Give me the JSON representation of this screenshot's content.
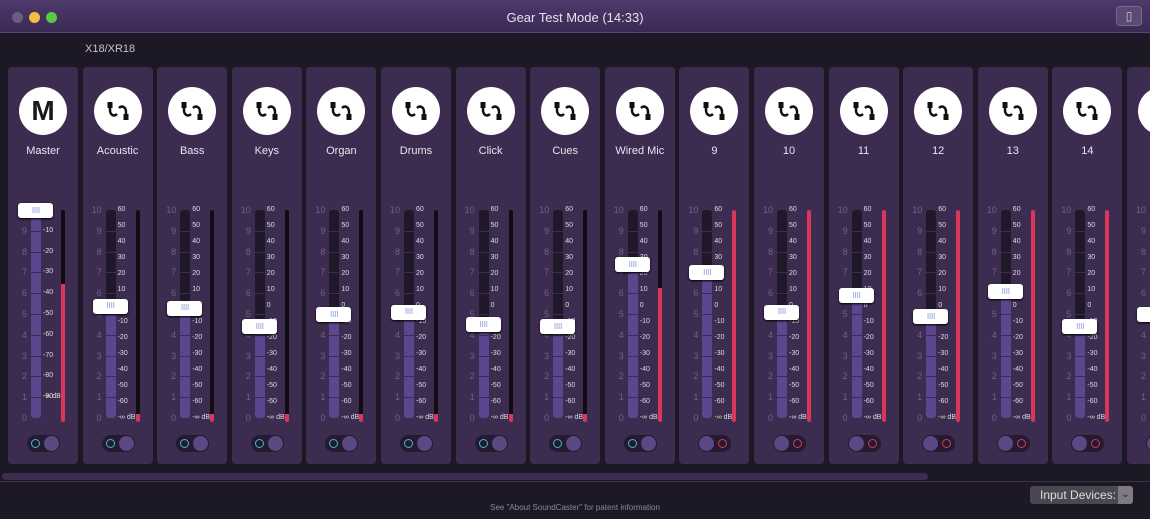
{
  "window": {
    "title": "Gear Test Mode (14:33)",
    "subtitle": "X18/XR18",
    "device_icon": "phone-icon"
  },
  "colors": {
    "meter": "#d8365a",
    "fader_fill": "#5d4690",
    "input_ring": "#3fb8c4",
    "output_ring": "#d8365a",
    "strip_bg": "#3c2d50"
  },
  "scales": {
    "fader": [
      "10",
      "9",
      "8",
      "7",
      "6",
      "5",
      "4",
      "3",
      "2",
      "1",
      "0"
    ],
    "channel_db": [
      "60",
      "50",
      "40",
      "30",
      "20",
      "10",
      "0",
      "-10",
      "-20",
      "-30",
      "-40",
      "-50",
      "-60",
      "-∞ dB"
    ],
    "master_db": [
      "-10",
      "-20",
      "-30",
      "-40",
      "-50",
      "-60",
      "-70",
      "-80",
      "-90",
      "-∞ dB"
    ]
  },
  "channels": [
    {
      "name": "Master",
      "icon": "M",
      "fader": 10,
      "meter": 0.65,
      "route": "input"
    },
    {
      "name": "Acoustic",
      "icon": "cable",
      "fader": 5.4,
      "meter": 0.04,
      "route": "input"
    },
    {
      "name": "Bass",
      "icon": "cable",
      "fader": 5.3,
      "meter": 0.04,
      "route": "input"
    },
    {
      "name": "Keys",
      "icon": "cable",
      "fader": 4.4,
      "meter": 0.04,
      "route": "input"
    },
    {
      "name": "Organ",
      "icon": "cable",
      "fader": 5.0,
      "meter": 0.04,
      "route": "input"
    },
    {
      "name": "Drums",
      "icon": "cable",
      "fader": 5.1,
      "meter": 0.04,
      "route": "input"
    },
    {
      "name": "Click",
      "icon": "cable",
      "fader": 4.5,
      "meter": 0.04,
      "route": "input"
    },
    {
      "name": "Cues",
      "icon": "cable",
      "fader": 4.4,
      "meter": 0.04,
      "route": "input"
    },
    {
      "name": "Wired Mic",
      "icon": "cable",
      "fader": 7.4,
      "meter": 0.63,
      "route": "input"
    },
    {
      "name": "9",
      "icon": "cable",
      "fader": 7.0,
      "meter": 1.0,
      "route": "output"
    },
    {
      "name": "10",
      "icon": "cable",
      "fader": 5.1,
      "meter": 1.0,
      "route": "output"
    },
    {
      "name": "11",
      "icon": "cable",
      "fader": 5.9,
      "meter": 1.0,
      "route": "output"
    },
    {
      "name": "12",
      "icon": "cable",
      "fader": 4.9,
      "meter": 1.0,
      "route": "output"
    },
    {
      "name": "13",
      "icon": "cable",
      "fader": 6.1,
      "meter": 1.0,
      "route": "output"
    },
    {
      "name": "14",
      "icon": "cable",
      "fader": 4.4,
      "meter": 1.0,
      "route": "output"
    },
    {
      "name": "",
      "icon": "cable",
      "fader": 5.0,
      "meter": 0.0,
      "route": "output"
    }
  ],
  "footer": {
    "patent": "See \"About SoundCaster\" for patent information",
    "input_devices": "Input Devices:"
  }
}
